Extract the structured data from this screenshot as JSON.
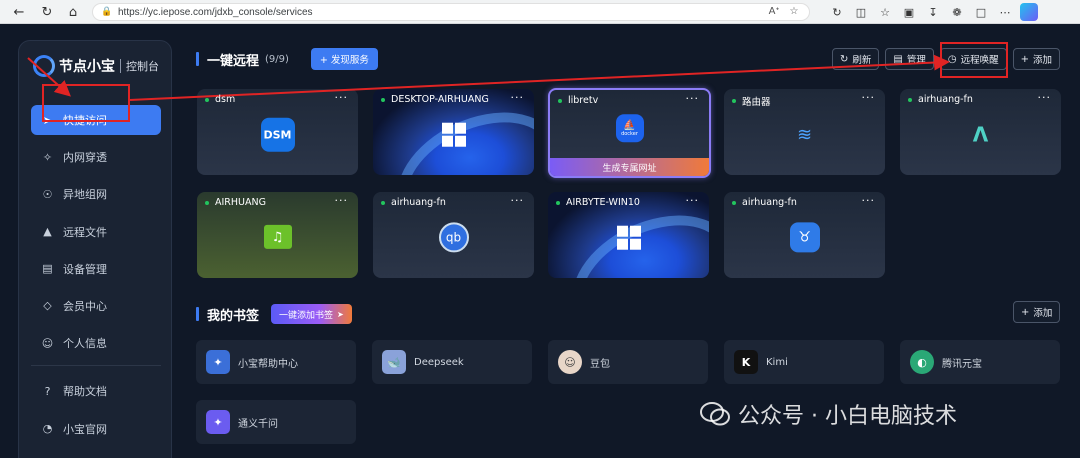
{
  "browser": {
    "url": "https://yc.iepose.com/jdxb_console/services"
  },
  "sidebar": {
    "brand": "节点小宝",
    "subtitle": "控制台",
    "items": [
      {
        "label": "快捷访问",
        "icon": "send-icon",
        "active": true
      },
      {
        "label": "内网穿透",
        "icon": "network-icon",
        "active": false
      },
      {
        "label": "异地组网",
        "icon": "globe-network-icon",
        "active": false
      },
      {
        "label": "远程文件",
        "icon": "upload-folder-icon",
        "active": false
      },
      {
        "label": "设备管理",
        "icon": "server-icon",
        "active": false
      },
      {
        "label": "会员中心",
        "icon": "diamond-icon",
        "active": false
      },
      {
        "label": "个人信息",
        "icon": "user-icon",
        "active": false
      }
    ],
    "footer_items": [
      {
        "label": "帮助文档",
        "icon": "help-doc-icon"
      },
      {
        "label": "小宝官网",
        "icon": "website-icon"
      }
    ]
  },
  "remote": {
    "title": "一键远程",
    "count": "(9/9)",
    "discover_label": "+ 发现服务",
    "refresh_label": "刷新",
    "manage_label": "管理",
    "wake_label": "远程唤醒",
    "add_label": "添加"
  },
  "devices": [
    {
      "name": "dsm",
      "icon": "dsm-icon",
      "icon_text": "DSM",
      "status": "online"
    },
    {
      "name": "DESKTOP-AIRHUANG",
      "icon": "windows-icon",
      "status": "online"
    },
    {
      "name": "libretv",
      "icon": "docker-icon",
      "icon_text": "docker",
      "status": "online",
      "action": "生成专属网址"
    },
    {
      "name": "路由器",
      "icon": "router-icon",
      "status": "online"
    },
    {
      "name": "airhuang-fn",
      "icon": "fnos-icon",
      "status": "online"
    },
    {
      "name": "AIRHUANG",
      "icon": "music-icon",
      "status": "online"
    },
    {
      "name": "airhuang-fn",
      "icon": "qbittorrent-icon",
      "icon_text": "qb",
      "status": "online"
    },
    {
      "name": "AIRBYTE-WIN10",
      "icon": "windows-icon",
      "status": "online"
    },
    {
      "name": "airhuang-fn",
      "icon": "bull-icon",
      "status": "online"
    }
  ],
  "bookmarks": {
    "title": "我的书签",
    "add_bookmark_label": "一键添加书签",
    "add_label": "添加",
    "items": [
      {
        "label": "小宝帮助中心",
        "icon": "xiaobao-icon",
        "color": "#3b6fd8"
      },
      {
        "label": "Deepseek",
        "icon": "deepseek-icon",
        "color": "#5b7bd5"
      },
      {
        "label": "豆包",
        "icon": "doubao-icon",
        "color": "#e8d6c8"
      },
      {
        "label": "Kimi",
        "icon": "kimi-icon",
        "color": "#111111"
      },
      {
        "label": "腾讯元宝",
        "icon": "yuanbao-icon",
        "color": "#2aa876"
      },
      {
        "label": "通义千问",
        "icon": "qwen-icon",
        "color": "#6b5cf0"
      }
    ]
  },
  "watermark": "公众号 · 小白电脑技术",
  "colors": {
    "accent": "#3d7bf2",
    "online": "#22c55e",
    "annotation": "#e02424"
  }
}
